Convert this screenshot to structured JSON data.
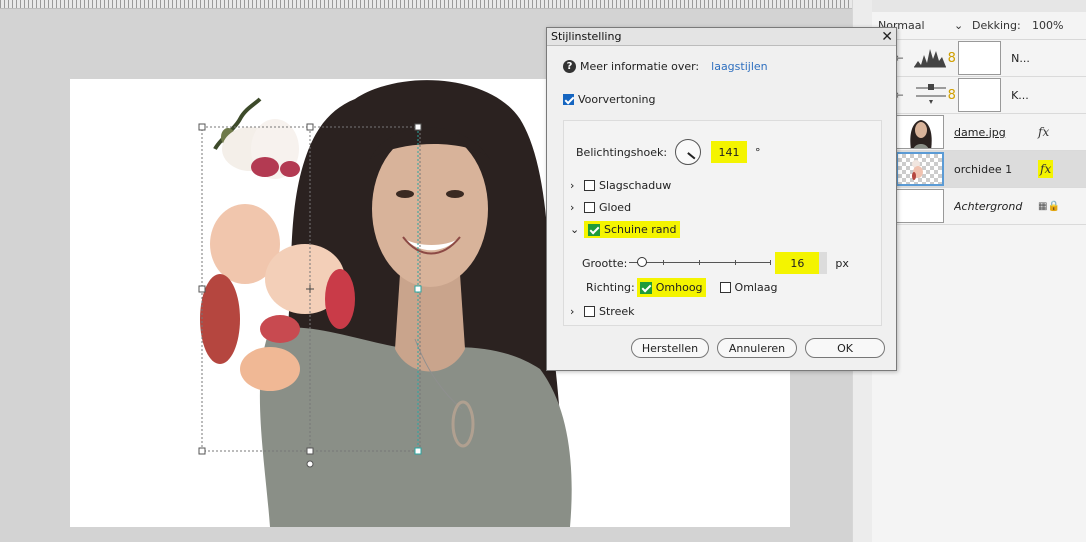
{
  "layers_panel": {
    "blend_mode": "Normaal",
    "opacity_label": "Dekking:",
    "opacity_value": "100%",
    "layers": [
      {
        "name": "N...",
        "kind": "adjustment-levels",
        "icon": "histogram-icon"
      },
      {
        "name": "K...",
        "kind": "adjustment-curves",
        "icon": "levels-slider-icon"
      },
      {
        "name": "dame.jpg",
        "kind": "photo",
        "fx": "fx"
      },
      {
        "name": "orchidee 1",
        "kind": "photo-selected",
        "fx": "fx"
      },
      {
        "name": "Achtergrond",
        "kind": "background"
      }
    ]
  },
  "dialog": {
    "title": "Stijlinstelling",
    "close": "✕",
    "info_text": "Meer informatie over:",
    "info_link": "laagstijlen",
    "preview_label": "Voorvertoning",
    "angle_label": "Belichtingshoek:",
    "angle_value": "141",
    "angle_unit": "°",
    "sections": {
      "drop_shadow": "Slagschaduw",
      "glow": "Gloed",
      "bevel": "Schuine rand",
      "stroke": "Streek"
    },
    "size_label": "Grootte:",
    "size_value": "16",
    "size_unit": "px",
    "size_slider_level": 0.05,
    "direction_label": "Richting:",
    "dir_up": "Omhoog",
    "dir_down": "Omlaag",
    "buttons": {
      "reset": "Herstellen",
      "cancel": "Annuleren",
      "ok": "OK"
    }
  },
  "colors": {
    "highlight": "#f4f400",
    "accent": "#1565c0",
    "link": "#2e6fbf"
  }
}
